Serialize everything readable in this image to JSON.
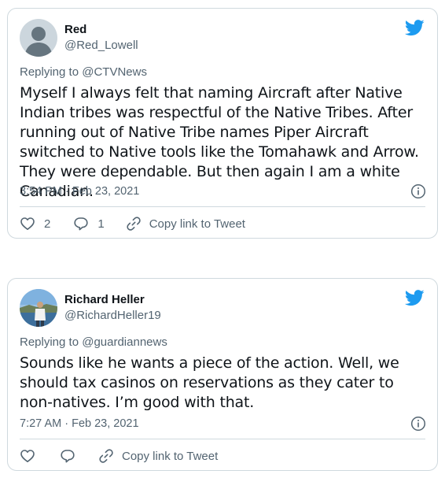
{
  "colors": {
    "bird": "#1d9bf0",
    "muted": "#536471",
    "text": "#0f1419",
    "border": "#cfd9de"
  },
  "tweets": [
    {
      "author_name": "Red",
      "author_handle": "@Red_Lowell",
      "reply_prefix": "Replying to",
      "reply_to": "@CTVNews",
      "text": "Myself I always felt that naming Aircraft after Native Indian tribes was respectful of the Native Tribes. After running out of Native Tribe names Piper Aircraft switched to Native tools like the Tomahawk and Arrow. They were dependable. But then again I am a white Canadian.",
      "timestamp": "3:54 PM · Feb 23, 2021",
      "likes": "2",
      "replies": "1",
      "copy_link_label": "Copy link to Tweet",
      "avatar": "default-avatar-icon"
    },
    {
      "author_name": "Richard Heller",
      "author_handle": "@RichardHeller19",
      "reply_prefix": "Replying to",
      "reply_to": "@guardiannews",
      "text": "Sounds like he wants a piece of the action. Well, we should tax casinos on reservations as they cater to non-natives. I’m good with that.",
      "timestamp": "7:27 AM · Feb 23, 2021",
      "likes": "",
      "replies": "",
      "copy_link_label": "Copy link to Tweet",
      "avatar": "photo-avatar"
    }
  ]
}
